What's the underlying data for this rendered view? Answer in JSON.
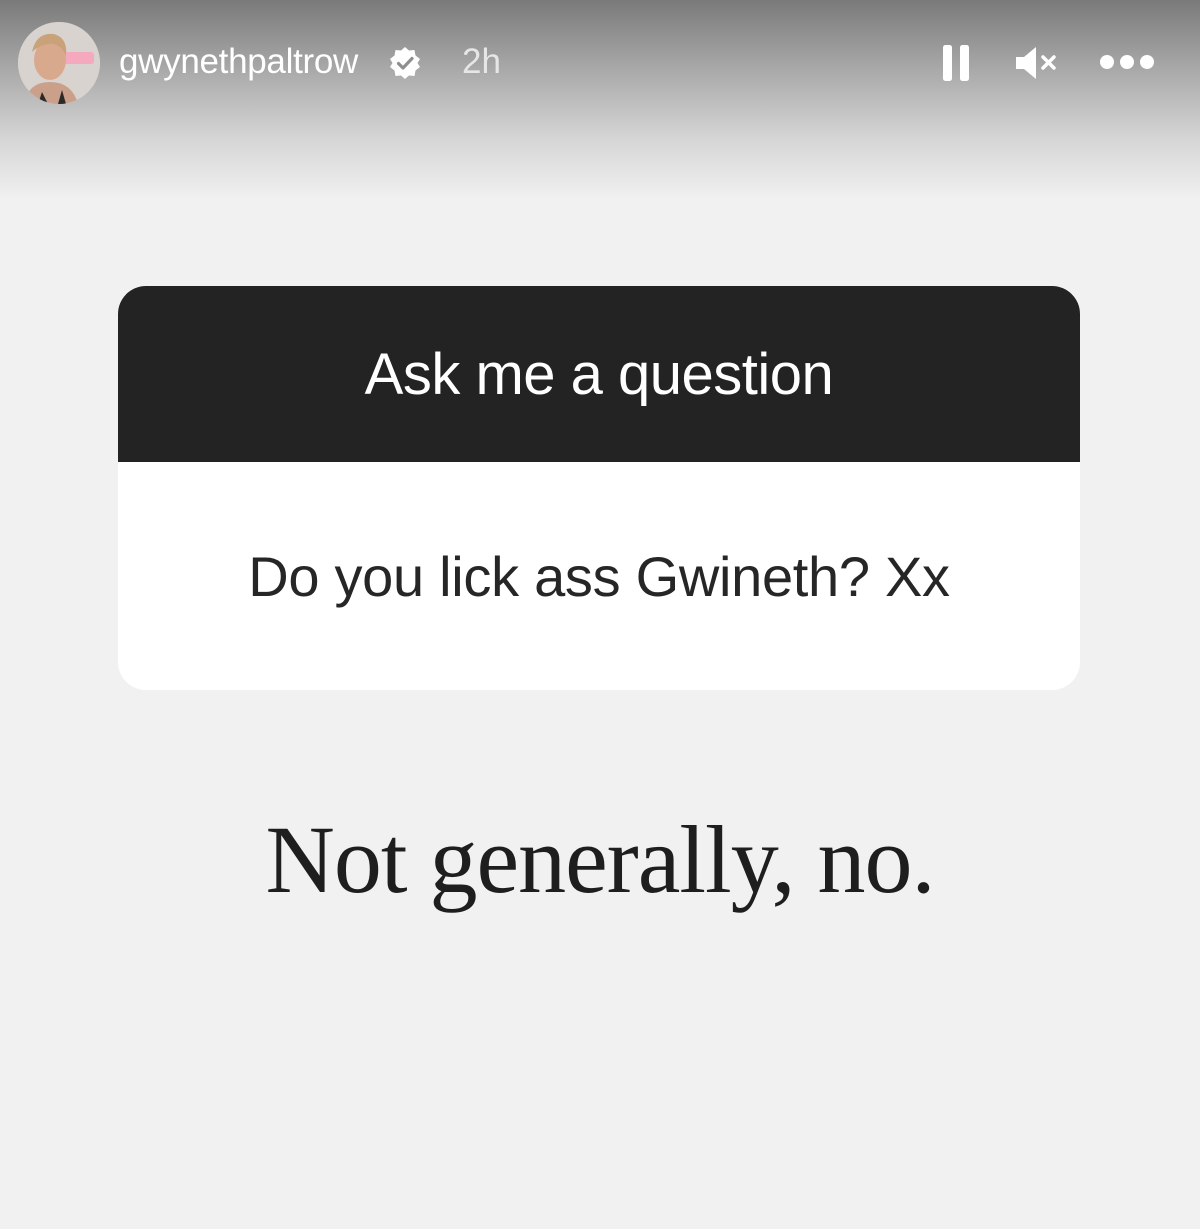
{
  "header": {
    "username": "gwynethpaltrow",
    "verified_icon": "verified-badge-icon",
    "time_ago": "2h",
    "controls": [
      "pause-icon",
      "mute-icon",
      "more-options-icon"
    ]
  },
  "question_sticker": {
    "prompt": "Ask me a question",
    "question": "Do you lick ass Gwineth? Xx"
  },
  "answer_text": "Not generally, no.",
  "colors": {
    "background": "#f1f1f1",
    "sticker_header": "#232323",
    "sticker_body": "#ffffff",
    "text_dark": "#262626"
  }
}
